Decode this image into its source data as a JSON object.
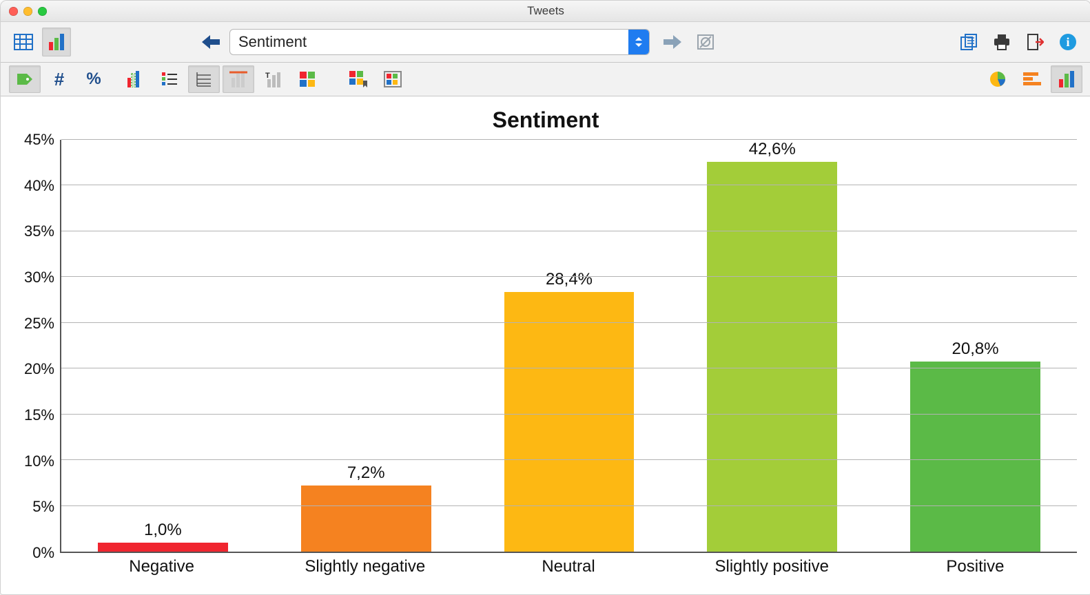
{
  "window": {
    "title": "Tweets"
  },
  "dropdown": {
    "selected": "Sentiment"
  },
  "chart_data": {
    "type": "bar",
    "title": "Sentiment",
    "categories": [
      "Negative",
      "Slightly negative",
      "Neutral",
      "Slightly positive",
      "Positive"
    ],
    "values": [
      1.0,
      7.2,
      28.4,
      42.6,
      20.8
    ],
    "value_labels": [
      "1,0%",
      "7,2%",
      "28,4%",
      "42,6%",
      "20,8%"
    ],
    "colors": [
      "#f0252f",
      "#f58220",
      "#fdb813",
      "#a3cd39",
      "#5bba47"
    ],
    "ylim": [
      0,
      45
    ],
    "y_ticks": [
      0,
      5,
      10,
      15,
      20,
      25,
      30,
      35,
      40,
      45
    ],
    "y_tick_labels": [
      "0%",
      "5%",
      "10%",
      "15%",
      "20%",
      "25%",
      "30%",
      "35%",
      "40%",
      "45%"
    ],
    "xlabel": "",
    "ylabel": ""
  }
}
